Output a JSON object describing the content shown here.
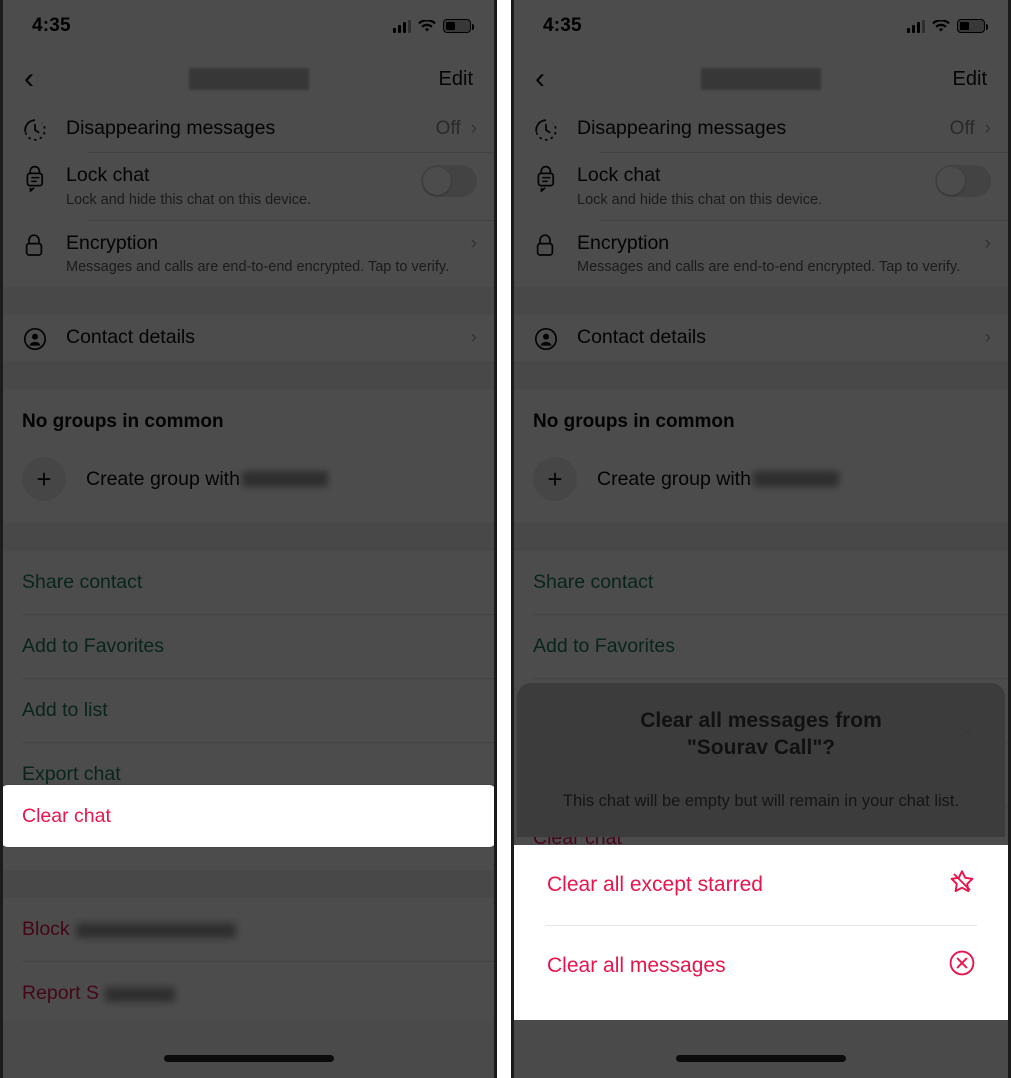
{
  "status_bar": {
    "time": "4:35",
    "cellular_icon": "cellular-bars-icon",
    "wifi_icon": "wifi-icon",
    "battery_icon": "battery-icon"
  },
  "nav": {
    "back_icon": "back-chevron-icon",
    "title_redacted": "",
    "edit_label": "Edit"
  },
  "settings_rows": [
    {
      "icon": "timer-icon",
      "title": "Disappearing messages",
      "subtitle": "",
      "value": "Off",
      "accessory": "chevron"
    },
    {
      "icon": "lock-chat-icon",
      "title": "Lock chat",
      "subtitle": "Lock and hide this chat on this device.",
      "value": "",
      "accessory": "toggle"
    },
    {
      "icon": "lock-icon",
      "title": "Encryption",
      "subtitle": "Messages and calls are end-to-end encrypted. Tap to verify.",
      "value": "",
      "accessory": "chevron"
    }
  ],
  "contact_row": {
    "icon": "contact-circle-icon",
    "title": "Contact details",
    "accessory": "chevron"
  },
  "groups": {
    "header": "No groups in common",
    "create_icon": "plus-icon",
    "create_label": "Create group with ",
    "create_name_redacted": ""
  },
  "actions": [
    {
      "label": "Share contact",
      "style": "green",
      "redacted": false
    },
    {
      "label": "Add to Favorites",
      "style": "green",
      "redacted": false
    },
    {
      "label": "Add to list",
      "style": "green",
      "redacted": false
    },
    {
      "label": "Export chat",
      "style": "green",
      "redacted": false
    },
    {
      "label": "Clear chat",
      "style": "red",
      "redacted": false,
      "highlighted": true
    }
  ],
  "danger_actions": [
    {
      "label": "Block",
      "style": "red",
      "redacted": true,
      "redact_width": 160
    },
    {
      "label": "Report S",
      "style": "red",
      "redacted": true,
      "redact_width": 70
    }
  ],
  "dialog": {
    "title_line1": "Clear all messages from",
    "title_line2": "\"Sourav Call\"?",
    "close_icon": "close-x-icon",
    "description": "This chat will be empty but will remain in your chat list.",
    "options": [
      {
        "label": "Clear all except starred",
        "icon": "star-slash-icon"
      },
      {
        "label": "Clear all messages",
        "icon": "x-circle-icon"
      }
    ]
  },
  "colors": {
    "destructive": "#e8144b",
    "link_green": "#1d7a5f",
    "scrim": "rgba(0,0,0,0.70)",
    "frame": "#4a4a4a"
  }
}
